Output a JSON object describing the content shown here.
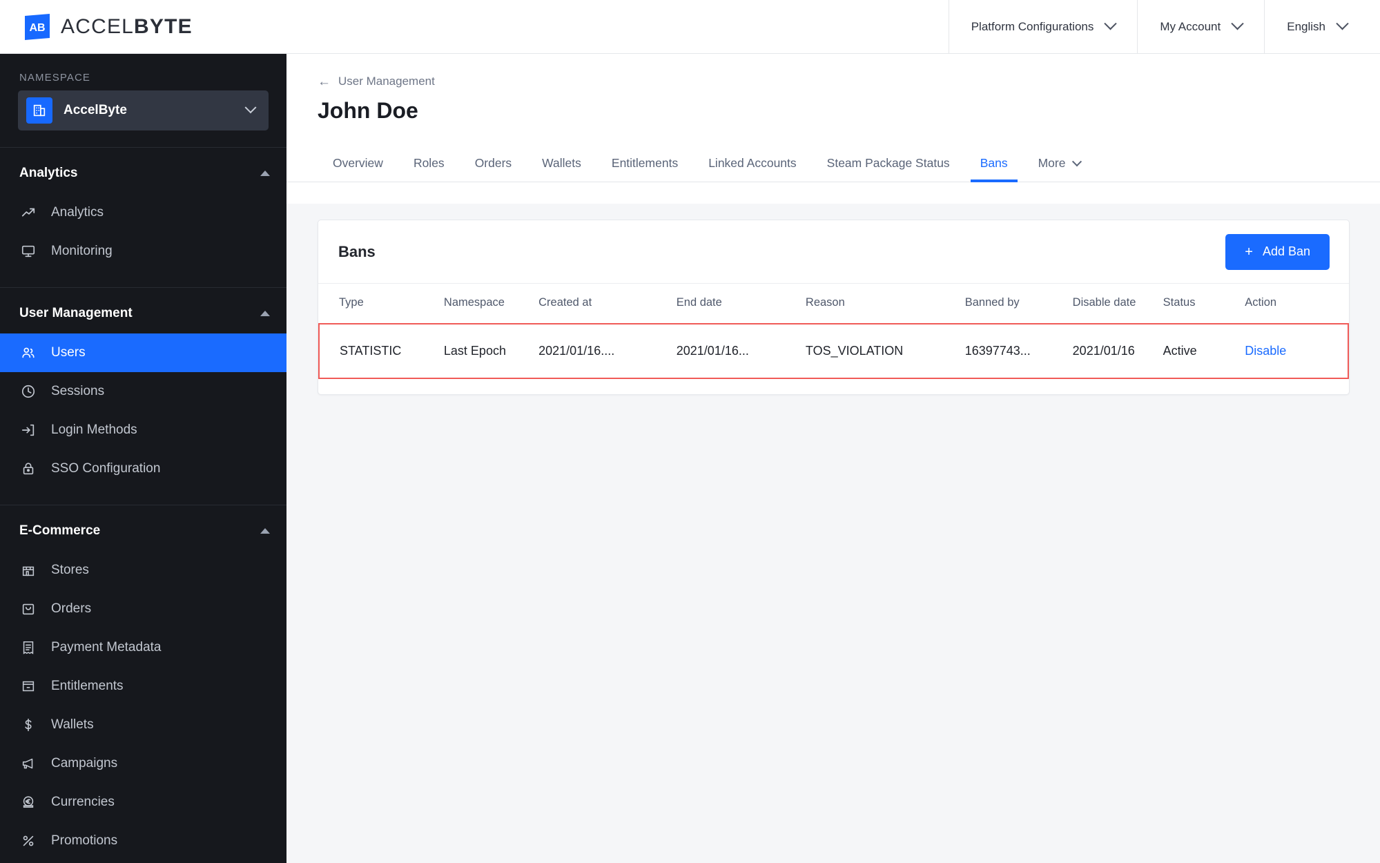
{
  "brand": {
    "logo_icon": "accelbyte-logo-icon",
    "name_light": "ACCEL",
    "name_bold": "BYTE"
  },
  "topnav": {
    "items": [
      {
        "label": "Platform Configurations",
        "icon": "chevron-down-icon"
      },
      {
        "label": "My Account",
        "icon": "chevron-down-icon"
      },
      {
        "label": "English",
        "icon": "chevron-down-icon"
      }
    ]
  },
  "sidebar": {
    "namespace_label": "NAMESPACE",
    "namespace_value": "AccelByte",
    "namespace_icon": "building-icon",
    "namespace_chevron": "chevron-down-icon",
    "groups": [
      {
        "title": "Analytics",
        "collapse_icon": "caret-up-icon",
        "items": [
          {
            "label": "Analytics",
            "icon": "trend-up-icon",
            "active": false
          },
          {
            "label": "Monitoring",
            "icon": "monitor-icon",
            "active": false
          }
        ]
      },
      {
        "title": "User Management",
        "collapse_icon": "caret-up-icon",
        "items": [
          {
            "label": "Users",
            "icon": "users-icon",
            "active": true
          },
          {
            "label": "Sessions",
            "icon": "clock-icon",
            "active": false
          },
          {
            "label": "Login Methods",
            "icon": "login-arrow-icon",
            "active": false
          },
          {
            "label": "SSO Configuration",
            "icon": "lock-icon",
            "active": false
          }
        ]
      },
      {
        "title": "E-Commerce",
        "collapse_icon": "caret-up-icon",
        "items": [
          {
            "label": "Stores",
            "icon": "store-icon",
            "active": false
          },
          {
            "label": "Orders",
            "icon": "bag-icon",
            "active": false
          },
          {
            "label": "Payment Metadata",
            "icon": "receipt-icon",
            "active": false
          },
          {
            "label": "Entitlements",
            "icon": "entitlement-box-icon",
            "active": false
          },
          {
            "label": "Wallets",
            "icon": "dollar-icon",
            "active": false
          },
          {
            "label": "Campaigns",
            "icon": "megaphone-icon",
            "active": false
          },
          {
            "label": "Currencies",
            "icon": "euro-coin-icon",
            "active": false
          },
          {
            "label": "Promotions",
            "icon": "percent-icon",
            "active": false
          }
        ]
      }
    ]
  },
  "main": {
    "breadcrumb": {
      "back_icon": "arrow-left-icon",
      "label": "User Management"
    },
    "page_title": "John Doe",
    "tabs": [
      {
        "label": "Overview",
        "active": false
      },
      {
        "label": "Roles",
        "active": false
      },
      {
        "label": "Orders",
        "active": false
      },
      {
        "label": "Wallets",
        "active": false
      },
      {
        "label": "Entitlements",
        "active": false
      },
      {
        "label": "Linked Accounts",
        "active": false
      },
      {
        "label": "Steam Package Status",
        "active": false
      },
      {
        "label": "Bans",
        "active": true
      }
    ],
    "more_tab": {
      "label": "More",
      "icon": "chevron-down-icon"
    },
    "card": {
      "title": "Bans",
      "add_button": {
        "label": "Add Ban",
        "icon": "plus-icon"
      },
      "columns": [
        "Type",
        "Namespace",
        "Created at",
        "End date",
        "Reason",
        "Banned by",
        "Disable date",
        "Status",
        "Action"
      ],
      "rows": [
        {
          "type": "STATISTIC",
          "namespace": "Last Epoch",
          "created_at": "2021/01/16....",
          "end_date": "2021/01/16...",
          "reason": "TOS_VIOLATION",
          "banned_by": "16397743...",
          "disable_date": "2021/01/16",
          "status": "Active",
          "action": "Disable",
          "highlighted": true
        }
      ]
    }
  },
  "colors": {
    "accent_blue": "#1a6bff",
    "sidebar_bg": "#16181d",
    "sidebar_select_bg": "#323743",
    "highlight_red": "#f05a57",
    "content_bg": "#f5f6f8"
  }
}
